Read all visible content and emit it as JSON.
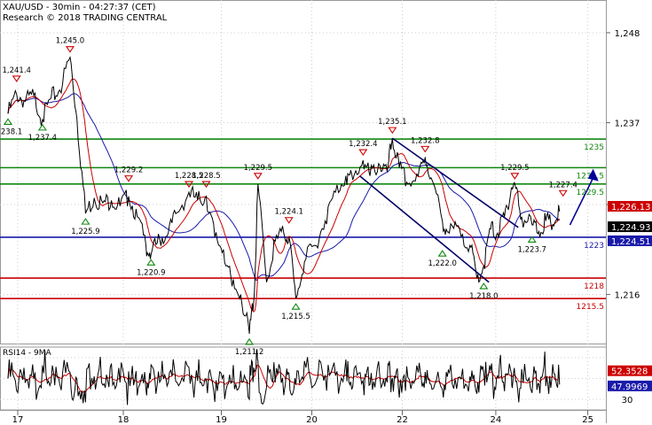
{
  "header": {
    "line1": "XAU/USD - 30min - 04:27:37 (CET)",
    "line2": "Research © 2018 TRADING CENTRAL"
  },
  "indicator": {
    "label": "RSI14 - 9MA"
  },
  "colors": {
    "price": "#000000",
    "ma_fast": "#cc0000",
    "ma_slow": "#1a1aaa",
    "support": "#1a1aaa",
    "resistance_green": "#118811",
    "resistance_red": "#cc0000",
    "channel": "#000066",
    "arrow": "#000099",
    "grid": "#cccccc",
    "last_price_bg": "#cc0000",
    "last_price2_bg": "#1a1aaa",
    "dark_label_bg": "#000000"
  },
  "chart_data": {
    "type": "line",
    "ylim": [
      1210,
      1252
    ],
    "y_ticks": [
      1216,
      1227,
      1237,
      1248
    ],
    "y_tick_labels": [
      "1,216",
      "1,227",
      "1,237",
      "1,248"
    ],
    "x_ticks": [
      "17",
      "18",
      "19",
      "20",
      "22",
      "24",
      "25"
    ],
    "horizontal_levels": [
      {
        "value": 1235,
        "label": "1235",
        "color": "green"
      },
      {
        "value": 1231.5,
        "label": "1231.5",
        "color": "green"
      },
      {
        "value": 1229.5,
        "label": "1229.5",
        "color": "green"
      },
      {
        "value": 1223,
        "label": "1223",
        "color": "blue"
      },
      {
        "value": 1218,
        "label": "1218",
        "color": "red"
      },
      {
        "value": 1215.5,
        "label": "1215.5",
        "color": "red"
      }
    ],
    "last_prices": [
      {
        "value": 1226.13,
        "label": "1,226.13",
        "color": "red"
      },
      {
        "value": 1224.93,
        "label": "1,224.93",
        "color": "dark"
      },
      {
        "value": 1224.51,
        "label": "1,224.51",
        "color": "blue"
      }
    ],
    "swing_highs": [
      {
        "x": 0.5,
        "value": 1241.4,
        "label": "1,241.4"
      },
      {
        "x": 3.6,
        "value": 1245.0,
        "label": "1,245.0"
      },
      {
        "x": 7.0,
        "value": 1229.2,
        "label": "1,229.2"
      },
      {
        "x": 10.5,
        "value": 1228.5,
        "label": "1,228.5"
      },
      {
        "x": 11.5,
        "value": 1228.5,
        "label": "1,228.5"
      },
      {
        "x": 14.5,
        "value": 1229.5,
        "label": "1,229.5"
      },
      {
        "x": 16.3,
        "value": 1224.1,
        "label": "1,224.1"
      },
      {
        "x": 20.6,
        "value": 1232.4,
        "label": "1,232.4"
      },
      {
        "x": 22.3,
        "value": 1235.1,
        "label": "1,235.1"
      },
      {
        "x": 24.2,
        "value": 1232.8,
        "label": "1,232.8"
      },
      {
        "x": 29.4,
        "value": 1229.5,
        "label": "1,229.5"
      },
      {
        "x": 32.2,
        "value": 1227.4,
        "label": "1,227.4"
      }
    ],
    "swing_lows": [
      {
        "x": 0.0,
        "value": 1238.1,
        "label": "1,238.1"
      },
      {
        "x": 2.0,
        "value": 1237.4,
        "label": "1,237.4"
      },
      {
        "x": 4.5,
        "value": 1225.9,
        "label": "1,225.9"
      },
      {
        "x": 8.3,
        "value": 1220.9,
        "label": "1,220.9"
      },
      {
        "x": 14.0,
        "value": 1211.2,
        "label": "1,211.2"
      },
      {
        "x": 16.7,
        "value": 1215.5,
        "label": "1,215.5"
      },
      {
        "x": 25.2,
        "value": 1222.0,
        "label": "1,222.0"
      },
      {
        "x": 27.6,
        "value": 1218.0,
        "label": "1,218.0"
      },
      {
        "x": 30.4,
        "value": 1223.7,
        "label": "1,223.7"
      }
    ],
    "series": [
      {
        "x": [
          0,
          0.5,
          1.0,
          1.5,
          2.0,
          2.5,
          3.0,
          3.6,
          4.0,
          4.5,
          5.0,
          5.5,
          6.0,
          6.5,
          7.0,
          7.5,
          8.0,
          8.3,
          8.8,
          9.3,
          9.8,
          10.5,
          11.0,
          11.5,
          12.0,
          12.5,
          13.0,
          13.5,
          14.0,
          14.3,
          14.5,
          15.0,
          15.5,
          16.0,
          16.3,
          16.7,
          17.2,
          17.8,
          18.4,
          19.0,
          19.6,
          20.0,
          20.6,
          21.0,
          21.5,
          22.0,
          22.3,
          22.7,
          23.2,
          23.8,
          24.2,
          24.6,
          25.2,
          25.6,
          26.2,
          26.8,
          27.2,
          27.6,
          28.0,
          28.4,
          28.8,
          29.2,
          29.4,
          29.8,
          30.4,
          30.8,
          31.2,
          31.6,
          32.0
        ],
        "values": [
          1238.1,
          1240.5,
          1239.6,
          1240.3,
          1237.4,
          1240.0,
          1241.0,
          1245.0,
          1237.5,
          1225.9,
          1227.8,
          1227.2,
          1227.5,
          1226.8,
          1228.0,
          1225.5,
          1222.0,
          1220.9,
          1222.8,
          1223.5,
          1226.0,
          1228.5,
          1227.5,
          1228.0,
          1223.0,
          1221.5,
          1217.0,
          1216.0,
          1211.2,
          1216.5,
          1229.5,
          1217.5,
          1222.5,
          1223.5,
          1223.0,
          1215.5,
          1220.0,
          1222.0,
          1225.0,
          1228.5,
          1230.5,
          1230.0,
          1232.4,
          1230.5,
          1232.0,
          1231.0,
          1235.1,
          1231.5,
          1229.5,
          1230.5,
          1232.8,
          1230.0,
          1225.0,
          1223.5,
          1224.0,
          1222.0,
          1218.0,
          1219.5,
          1224.0,
          1223.5,
          1225.5,
          1229.0,
          1229.5,
          1225.5,
          1224.5,
          1223.7,
          1225.0,
          1224.5,
          1226.13
        ]
      }
    ],
    "rsi": {
      "ylim": [
        20,
        80
      ],
      "tick_labels": [
        "30"
      ],
      "last_values": [
        {
          "value": 52.3528,
          "label": "52.3528",
          "color": "red"
        },
        {
          "value": 47.9969,
          "label": "47.9969",
          "color": "blue"
        }
      ]
    }
  }
}
